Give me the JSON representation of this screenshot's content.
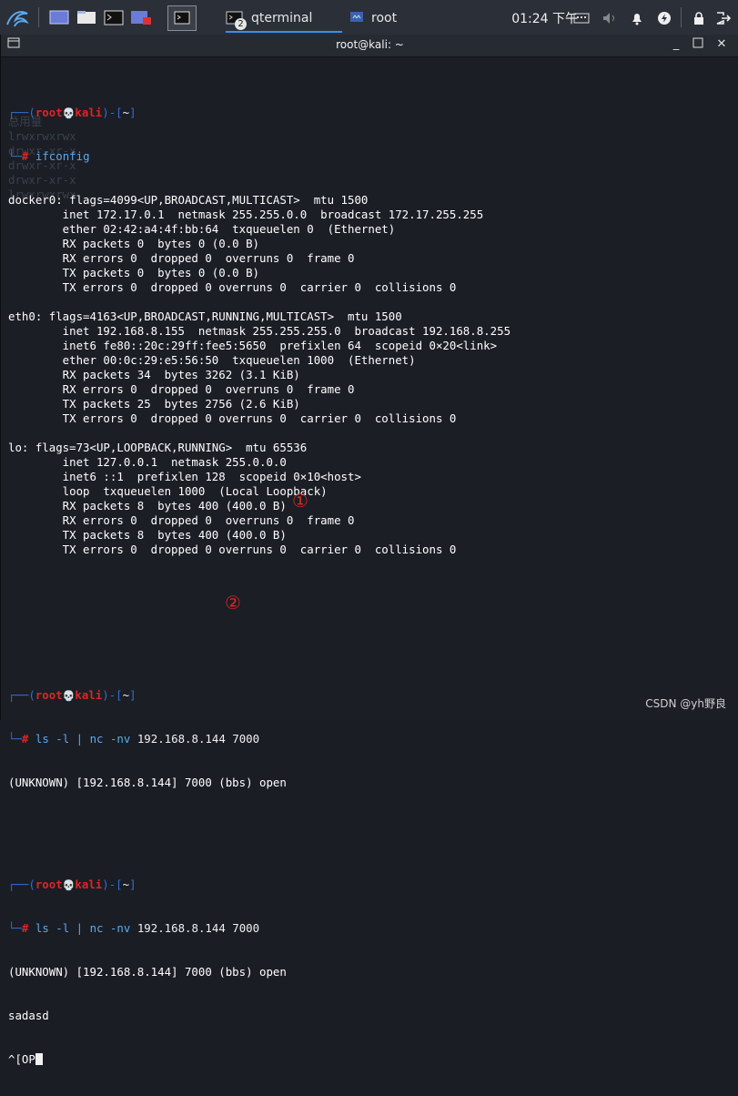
{
  "taskbar": {
    "tasks": [
      {
        "label": "qterminal",
        "badge": "2",
        "icon": "terminal-icon"
      },
      {
        "label": "root",
        "icon": "folder-icon"
      }
    ],
    "clock": "01:24 下午",
    "tray_icons": [
      "keyboard-icon",
      "volume-icon",
      "bell-icon",
      "power-icon",
      "lock-icon",
      "logout-icon"
    ]
  },
  "window": {
    "title": "root@kali: ~"
  },
  "terminal": {
    "prompt_user": "root",
    "prompt_host": "kali",
    "prompt_dir": "~",
    "prompt_skull": "💀",
    "blocks": [
      {
        "cmd": "ifconfig"
      },
      {
        "cmd": "ls -l | nc -nv 192.168.8.144 7000"
      },
      {
        "cmd": "ls -l | nc -nv 192.168.8.144 7000"
      }
    ],
    "ifconfig_output": [
      "docker0: flags=4099<UP,BROADCAST,MULTICAST>  mtu 1500",
      "        inet 172.17.0.1  netmask 255.255.0.0  broadcast 172.17.255.255",
      "        ether 02:42:a4:4f:bb:64  txqueuelen 0  (Ethernet)",
      "        RX packets 0  bytes 0 (0.0 B)",
      "        RX errors 0  dropped 0  overruns 0  frame 0",
      "        TX packets 0  bytes 0 (0.0 B)",
      "        TX errors 0  dropped 0 overruns 0  carrier 0  collisions 0",
      "",
      "eth0: flags=4163<UP,BROADCAST,RUNNING,MULTICAST>  mtu 1500",
      "        inet 192.168.8.155  netmask 255.255.255.0  broadcast 192.168.8.255",
      "        inet6 fe80::20c:29ff:fee5:5650  prefixlen 64  scopeid 0×20<link>",
      "        ether 00:0c:29:e5:56:50  txqueuelen 1000  (Ethernet)",
      "        RX packets 34  bytes 3262 (3.1 KiB)",
      "        RX errors 0  dropped 0  overruns 0  frame 0",
      "        TX packets 25  bytes 2756 (2.6 KiB)",
      "        TX errors 0  dropped 0 overruns 0  carrier 0  collisions 0",
      "",
      "lo: flags=73<UP,LOOPBACK,RUNNING>  mtu 65536",
      "        inet 127.0.0.1  netmask 255.0.0.0",
      "        inet6 ::1  prefixlen 128  scopeid 0×10<host>",
      "        loop  txqueuelen 1000  (Local Loopback)",
      "        RX packets 8  bytes 400 (400.0 B)",
      "        RX errors 0  dropped 0  overruns 0  frame 0",
      "        TX packets 8  bytes 400 (400.0 B)",
      "        TX errors 0  dropped 0 overruns 0  carrier 0  collisions 0"
    ],
    "nc_output_1": "(UNKNOWN) [192.168.8.144] 7000 (bbs) open",
    "nc_output_2": "(UNKNOWN) [192.168.8.144] 7000 (bbs) open",
    "typed_1": "sadasd",
    "typed_2": "^[OP",
    "marker_1": "①",
    "marker_2": "②"
  },
  "watermark": "CSDN @yh野良",
  "colors": {
    "prompt_frame": "#2e6fd4",
    "prompt_user": "#e02424",
    "marker": "#e02424"
  }
}
